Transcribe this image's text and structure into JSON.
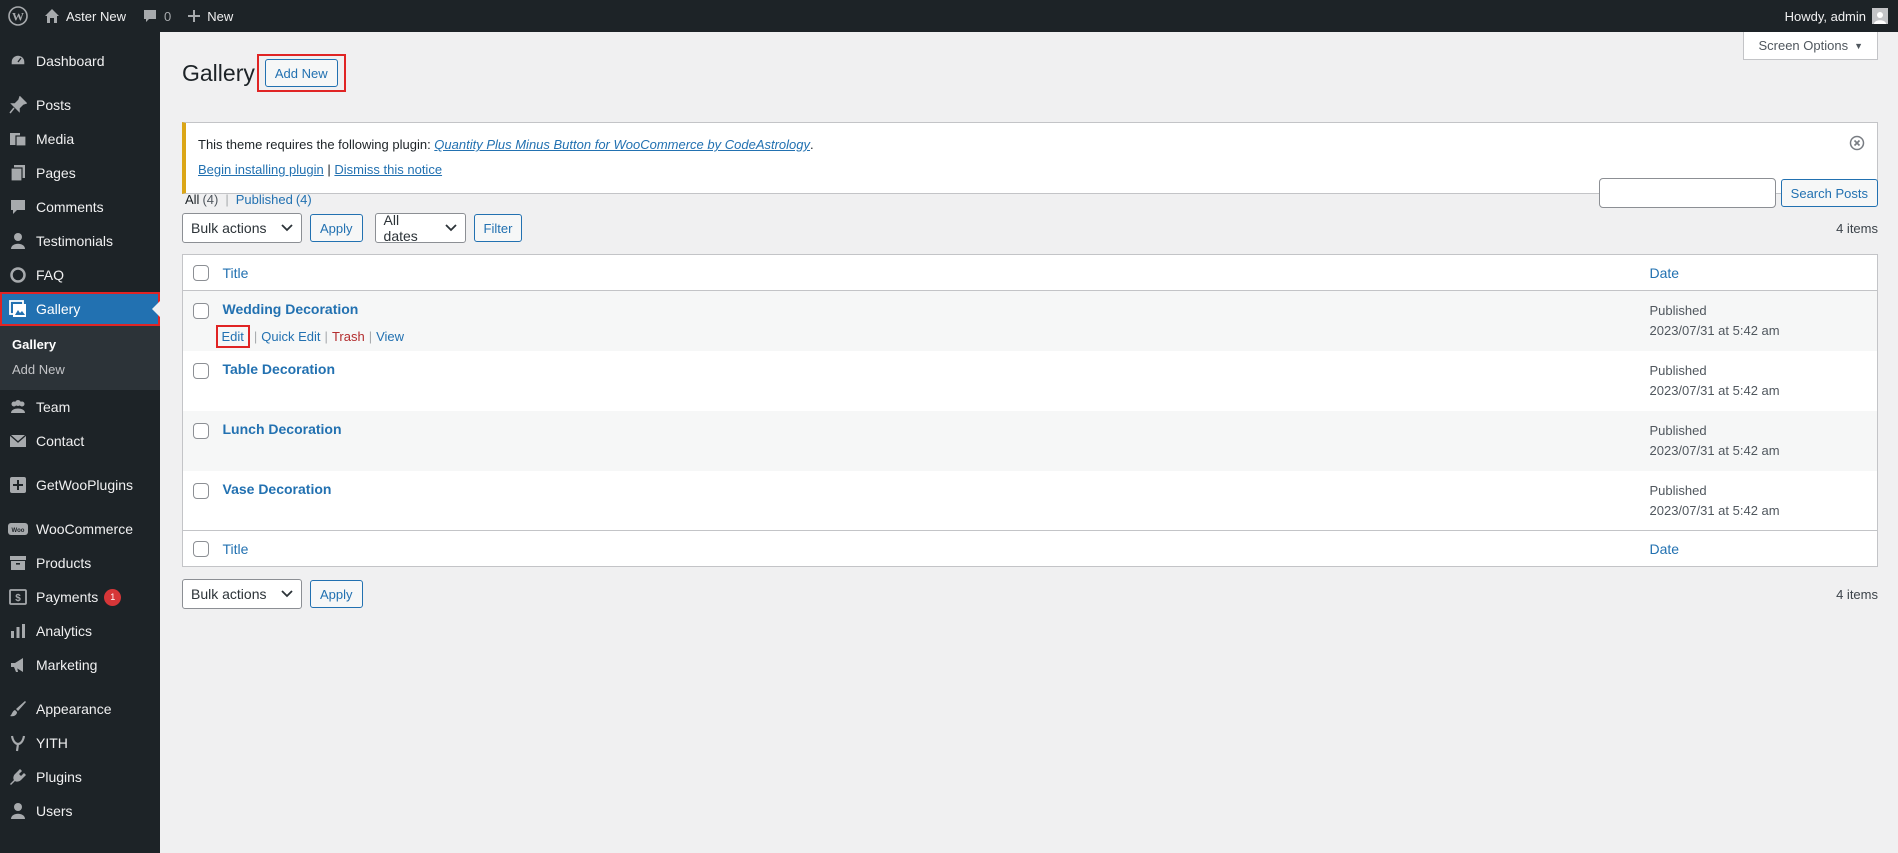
{
  "adminbar": {
    "site_name": "Aster New",
    "comments_count": "0",
    "new_label": "New",
    "howdy": "Howdy, admin"
  },
  "sidebar": {
    "items": [
      {
        "label": "Dashboard",
        "icon": "dashboard-icon"
      },
      {
        "label": "Posts",
        "icon": "pushpin-icon"
      },
      {
        "label": "Media",
        "icon": "media-icon"
      },
      {
        "label": "Pages",
        "icon": "pages-icon"
      },
      {
        "label": "Comments",
        "icon": "comment-icon"
      },
      {
        "label": "Testimonials",
        "icon": "person-icon"
      },
      {
        "label": "FAQ",
        "icon": "circle-icon"
      },
      {
        "label": "Gallery",
        "icon": "gallery-icon"
      },
      {
        "label": "Team",
        "icon": "groups-icon"
      },
      {
        "label": "Contact",
        "icon": "email-icon"
      },
      {
        "label": "GetWooPlugins",
        "icon": "plugin-grid-icon"
      },
      {
        "label": "WooCommerce",
        "icon": "woo-icon"
      },
      {
        "label": "Products",
        "icon": "archive-icon"
      },
      {
        "label": "Payments",
        "icon": "money-icon",
        "badge": "1"
      },
      {
        "label": "Analytics",
        "icon": "bar-chart-icon"
      },
      {
        "label": "Marketing",
        "icon": "megaphone-icon"
      },
      {
        "label": "Appearance",
        "icon": "paintbrush-icon"
      },
      {
        "label": "YITH",
        "icon": "yith-icon"
      },
      {
        "label": "Plugins",
        "icon": "plugin-icon"
      },
      {
        "label": "Users",
        "icon": "users-icon"
      }
    ],
    "submenu": {
      "gallery": "Gallery",
      "add_new": "Add New"
    }
  },
  "screen_options": "Screen Options",
  "page": {
    "title": "Gallery",
    "add_new": "Add New"
  },
  "notice": {
    "text_before": "This theme requires the following plugin: ",
    "plugin_link": "Quantity Plus Minus Button for WooCommerce by CodeAstrology",
    "text_after": ".",
    "begin_install": "Begin installing plugin",
    "separator": "|",
    "dismiss": "Dismiss this notice"
  },
  "views": {
    "all": "All",
    "all_count": "(4)",
    "published": "Published",
    "published_count": "(4)"
  },
  "search": {
    "button": "Search Posts",
    "value": ""
  },
  "tablenav": {
    "bulk_actions": "Bulk actions",
    "apply": "Apply",
    "all_dates": "All dates",
    "filter": "Filter",
    "items_count": "4 items"
  },
  "table": {
    "col_title": "Title",
    "col_date": "Date",
    "rows": [
      {
        "title": "Wedding Decoration",
        "status": "Published",
        "date": "2023/07/31 at 5:42 am"
      },
      {
        "title": "Table Decoration",
        "status": "Published",
        "date": "2023/07/31 at 5:42 am"
      },
      {
        "title": "Lunch Decoration",
        "status": "Published",
        "date": "2023/07/31 at 5:42 am"
      },
      {
        "title": "Vase Decoration",
        "status": "Published",
        "date": "2023/07/31 at 5:42 am"
      }
    ],
    "row_actions": {
      "edit": "Edit",
      "quick_edit": "Quick Edit",
      "trash": "Trash",
      "view": "View"
    }
  }
}
